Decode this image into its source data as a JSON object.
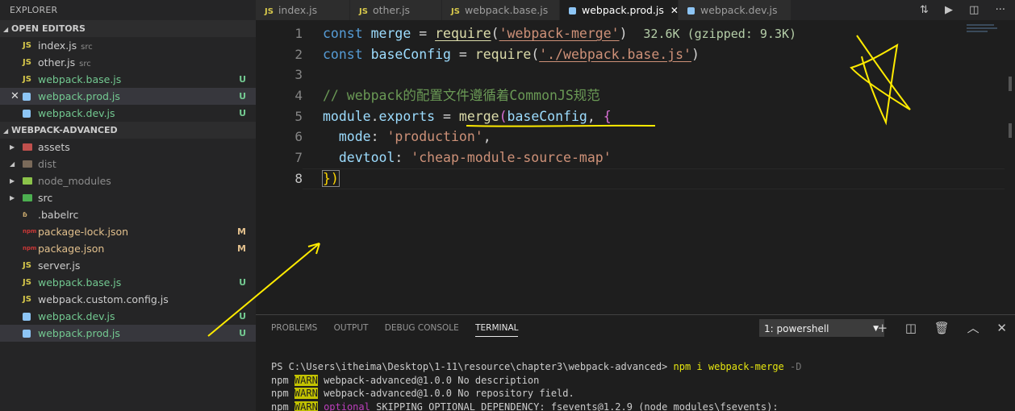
{
  "sidebar": {
    "title": "EXPLORER",
    "open_editors_label": "OPEN EDITORS",
    "project_label": "WEBPACK-ADVANCED",
    "open_editors": [
      {
        "icon": "JS",
        "name": "index.js",
        "sub": "src",
        "status": ""
      },
      {
        "icon": "JS",
        "name": "other.js",
        "sub": "src",
        "status": ""
      },
      {
        "icon": "JS",
        "name": "webpack.base.js",
        "sub": "",
        "status": "U"
      },
      {
        "icon": "WP",
        "name": "webpack.prod.js",
        "sub": "",
        "status": "U"
      },
      {
        "icon": "WP",
        "name": "webpack.dev.js",
        "sub": "",
        "status": "U"
      }
    ],
    "tree": [
      {
        "name": "assets",
        "status": ""
      },
      {
        "name": "dist",
        "status": ""
      },
      {
        "name": "node_modules",
        "status": ""
      },
      {
        "name": "src",
        "status": ""
      },
      {
        "name": ".babelrc",
        "status": ""
      },
      {
        "name": "package-lock.json",
        "status": "M"
      },
      {
        "name": "package.json",
        "status": "M"
      },
      {
        "name": "server.js",
        "status": ""
      },
      {
        "name": "webpack.base.js",
        "status": "U"
      },
      {
        "name": "webpack.custom.config.js",
        "status": ""
      },
      {
        "name": "webpack.dev.js",
        "status": "U"
      },
      {
        "name": "webpack.prod.js",
        "status": "U"
      }
    ]
  },
  "tabs": [
    {
      "icon": "JS",
      "label": "index.js"
    },
    {
      "icon": "JS",
      "label": "other.js"
    },
    {
      "icon": "JS",
      "label": "webpack.base.js"
    },
    {
      "icon": "WP",
      "label": "webpack.prod.js",
      "active": true
    },
    {
      "icon": "WP",
      "label": "webpack.dev.js"
    }
  ],
  "editor": {
    "line_numbers": [
      "1",
      "2",
      "3",
      "4",
      "5",
      "6",
      "7",
      "8"
    ],
    "lines": [
      {
        "t1": "const",
        "t2": "merge",
        "t3": "=",
        "t4": "require",
        "t5": "'webpack-merge'",
        "hint": "32.6K (gzipped: 9.3K)"
      },
      {
        "t1": "const",
        "t2": "baseConfig",
        "t3": "=",
        "t4": "require",
        "t5": "'./webpack.base.js'"
      },
      {},
      {
        "comment": "// webpack的配置文件遵循着CommonJS规范"
      },
      {
        "t1": "module",
        "t2": "exports",
        "t3": "merge",
        "t4": "baseConfig"
      },
      {
        "key": "mode",
        "val": "'production'"
      },
      {
        "key": "devtool",
        "val": "'cheap-module-source-map'"
      },
      {
        "end": "})"
      }
    ]
  },
  "panel": {
    "tabs": [
      "PROBLEMS",
      "OUTPUT",
      "DEBUG CONSOLE",
      "TERMINAL"
    ],
    "terminal_select": "1: powershell",
    "terminal": {
      "prompt": "PS C:\\Users\\itheima\\Desktop\\1-11\\resource\\chapter3\\webpack-advanced>",
      "command": "npm i webpack-merge",
      "flag": "-D",
      "lines": [
        {
          "npm": "npm",
          "warn": "WARN",
          "tag": "",
          "msg": "webpack-advanced@1.0.0 No description"
        },
        {
          "npm": "npm",
          "warn": "WARN",
          "tag": "",
          "msg": "webpack-advanced@1.0.0 No repository field."
        },
        {
          "npm": "npm",
          "warn": "WARN",
          "tag": "optional",
          "msg": "SKIPPING OPTIONAL DEPENDENCY: fsevents@1.2.9 (node_modules\\fsevents):"
        }
      ]
    }
  },
  "colors": {
    "accent_untracked": "#73c991",
    "accent_modified": "#e2c08d",
    "annotation": "#ffeb00"
  }
}
